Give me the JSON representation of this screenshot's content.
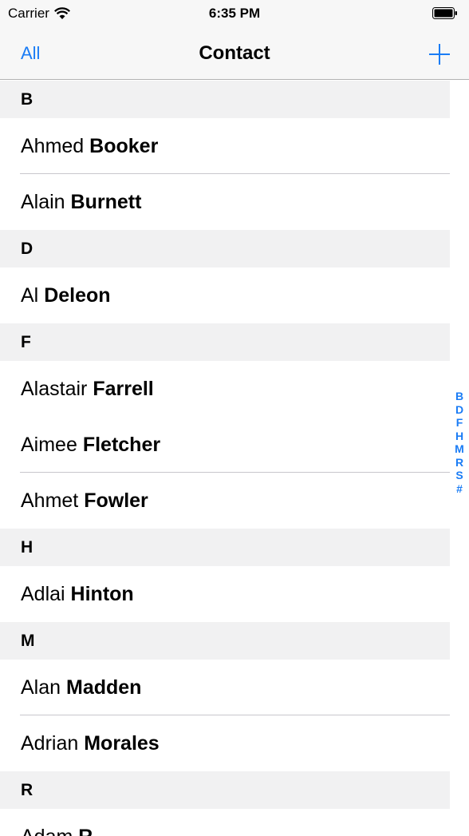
{
  "status_bar": {
    "carrier": "Carrier",
    "time": "6:35 PM"
  },
  "nav": {
    "left_label": "All",
    "title": "Contact"
  },
  "sections": [
    {
      "letter": "B",
      "contacts": [
        {
          "first": "Ahmed",
          "last": "Booker"
        },
        {
          "first": "Alain",
          "last": "Burnett"
        }
      ]
    },
    {
      "letter": "D",
      "contacts": [
        {
          "first": "Al",
          "last": "Deleon"
        }
      ]
    },
    {
      "letter": "F",
      "contacts": [
        {
          "first": "Alastair",
          "last": "Farrell"
        },
        {
          "first": "Aimee",
          "last": "Fletcher"
        },
        {
          "first": "Ahmet",
          "last": "Fowler"
        }
      ]
    },
    {
      "letter": "H",
      "contacts": [
        {
          "first": "Adlai",
          "last": "Hinton"
        }
      ]
    },
    {
      "letter": "M",
      "contacts": [
        {
          "first": "Alan",
          "last": "Madden"
        },
        {
          "first": "Adrian",
          "last": "Morales"
        }
      ]
    },
    {
      "letter": "R",
      "contacts": [
        {
          "first": "Adam",
          "last": "R"
        }
      ]
    }
  ],
  "index_letters": [
    "B",
    "D",
    "F",
    "H",
    "M",
    "R",
    "S",
    "#"
  ],
  "colors": {
    "accent": "#1a7cf5",
    "section_bg": "#f1f1f2",
    "bar_bg": "#f7f7f7"
  }
}
